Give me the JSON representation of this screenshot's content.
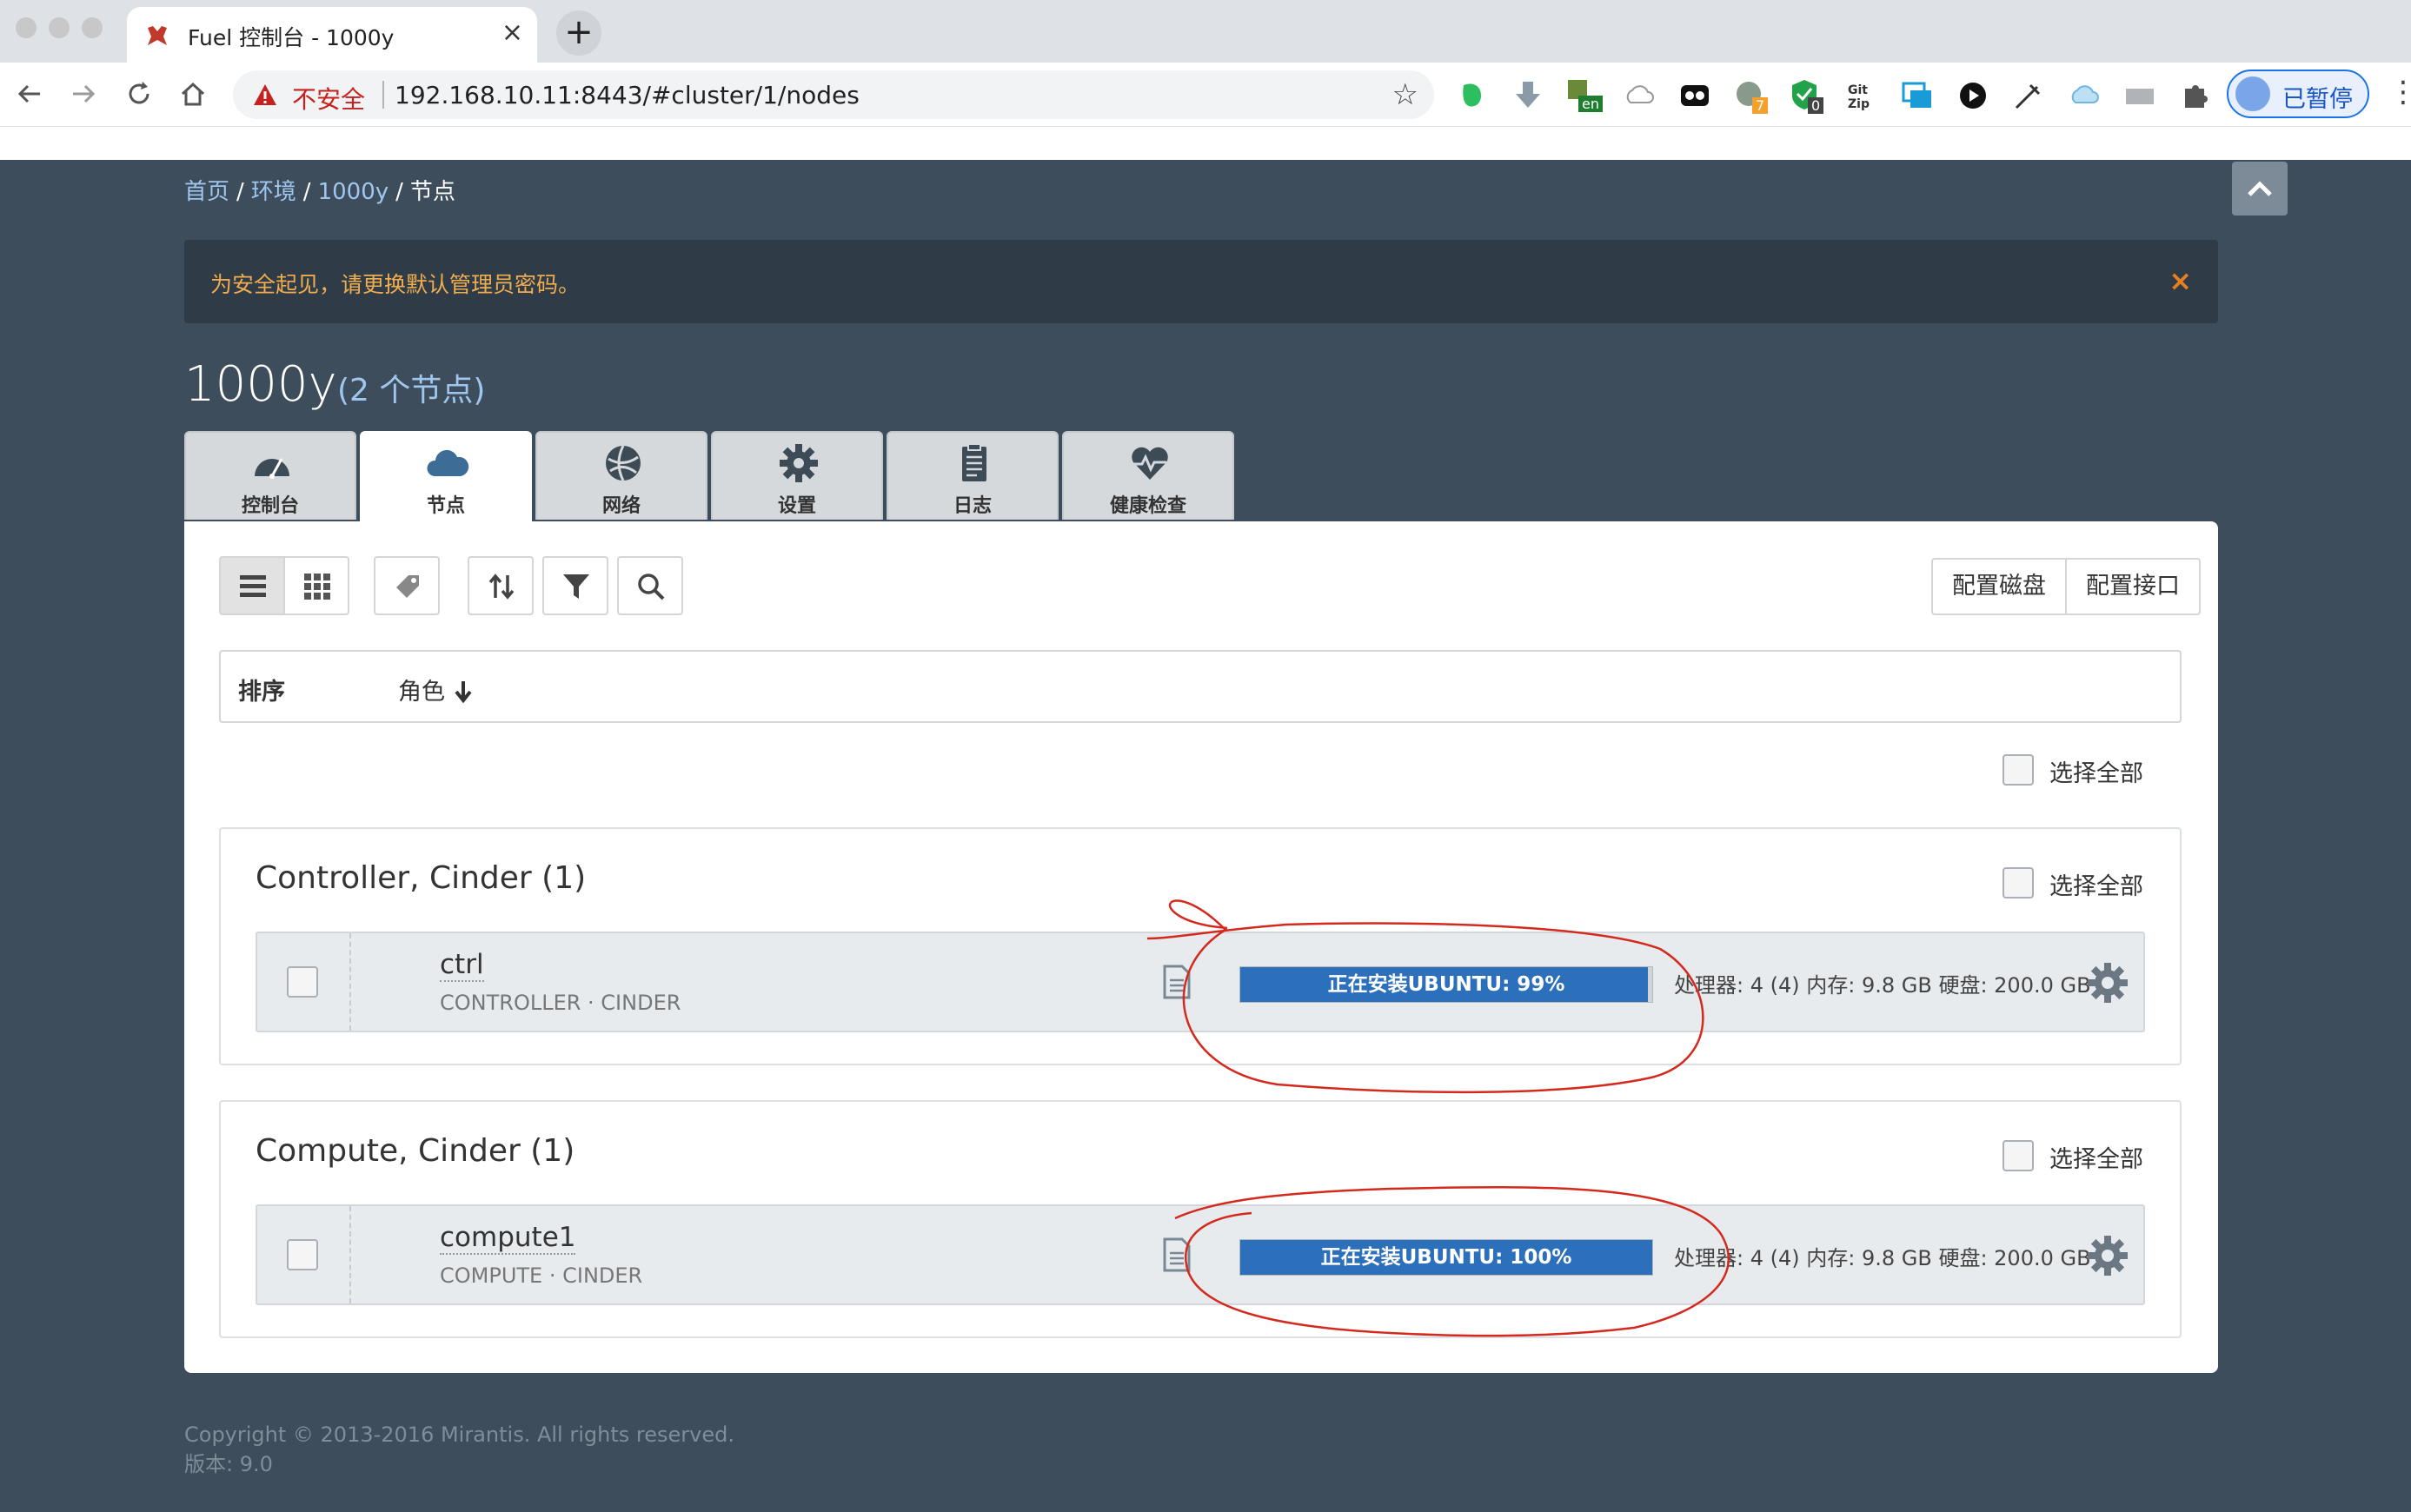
{
  "browser": {
    "tab_title": "Fuel 控制台 - 1000y",
    "tab_close": "×",
    "new_tab": "+",
    "insecure_label": "不安全",
    "url": "192.168.10.11:8443/#cluster/1/nodes",
    "profile_label": "已暂停",
    "ext_badges": [
      "en",
      "7",
      "0"
    ]
  },
  "breadcrumb": {
    "home": "首页",
    "envs": "环境",
    "env": "1000y",
    "current": "节点",
    "sep": "/"
  },
  "alert": {
    "text": "为安全起见，请更换默认管理员密码。",
    "close": "×"
  },
  "env": {
    "name": "1000y",
    "count": "(2 个节点)"
  },
  "tabs": [
    {
      "label": "控制台",
      "icon": "dashboard-icon"
    },
    {
      "label": "节点",
      "icon": "cloud-icon"
    },
    {
      "label": "网络",
      "icon": "network-globe-icon"
    },
    {
      "label": "设置",
      "icon": "gear-icon"
    },
    {
      "label": "日志",
      "icon": "clipboard-icon"
    },
    {
      "label": "健康检查",
      "icon": "heart-pulse-icon"
    }
  ],
  "toolbar": {
    "config_disks": "配置磁盘",
    "config_interfaces": "配置接口"
  },
  "sort": {
    "label": "排序",
    "role": "角色"
  },
  "select_all": "选择全部",
  "groups": [
    {
      "title": "Controller, Cinder (1)",
      "node": {
        "name": "ctrl",
        "roles": "CONTROLLER · CINDER",
        "status": "正在安装UBUNTU: 99%",
        "progress": 99,
        "specs": "处理器: 4 (4)  内存: 9.8 GB  硬盘: 200.0 GB"
      }
    },
    {
      "title": "Compute, Cinder (1)",
      "node": {
        "name": "compute1",
        "roles": "COMPUTE · CINDER",
        "status": "正在安装UBUNTU: 100%",
        "progress": 100,
        "specs": "处理器: 4 (4)  内存: 9.8 GB  硬盘: 200.0 GB"
      }
    }
  ],
  "footer": {
    "copyright": "Copyright © 2013-2016 Mirantis. All rights reserved.",
    "version": "版本: 9.0"
  },
  "colors": {
    "accent": "#2c6fbb",
    "background": "#3e4d5b",
    "alert_text": "#f0ad4e",
    "annotation": "#d42a1e"
  }
}
